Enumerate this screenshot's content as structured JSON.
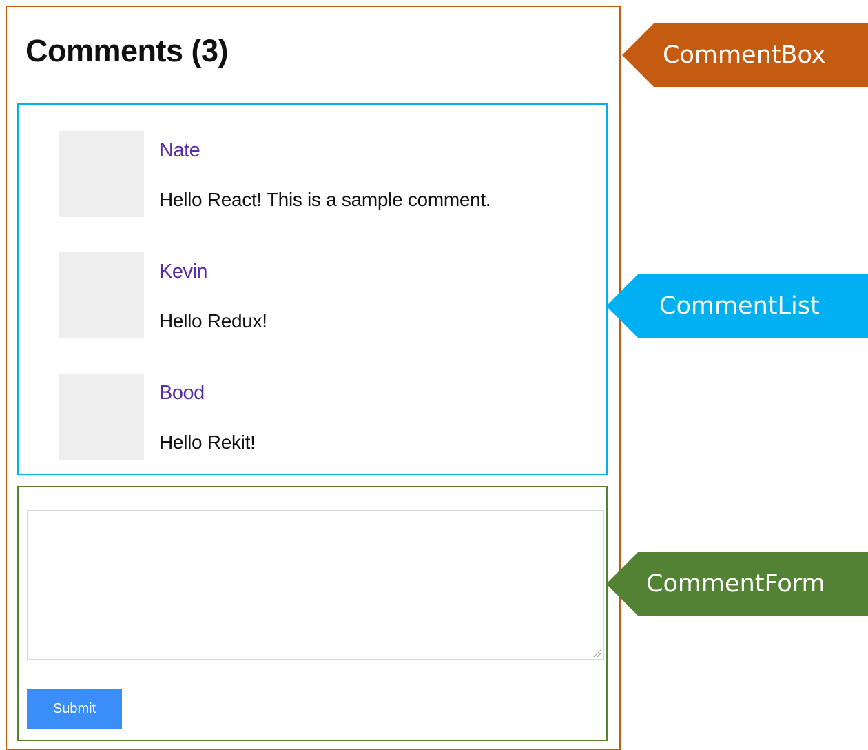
{
  "comment_box": {
    "title": "Comments (3)"
  },
  "comments": [
    {
      "author": "Nate",
      "text": "Hello React! This is a sample comment."
    },
    {
      "author": "Kevin",
      "text": "Hello Redux!"
    },
    {
      "author": "Bood",
      "text": "Hello Rekit!"
    }
  ],
  "form": {
    "textarea_value": "",
    "submit_label": "Submit"
  },
  "callouts": {
    "comment_box": "CommentBox",
    "comment_list": "CommentList",
    "comment_form": "CommentForm"
  },
  "colors": {
    "comment_box": "#c55a11",
    "comment_list": "#00b0f0",
    "comment_form": "#548235",
    "author_link": "#5b2ca8",
    "submit_button": "#3b8ef7",
    "avatar_placeholder": "#eeeeee"
  }
}
